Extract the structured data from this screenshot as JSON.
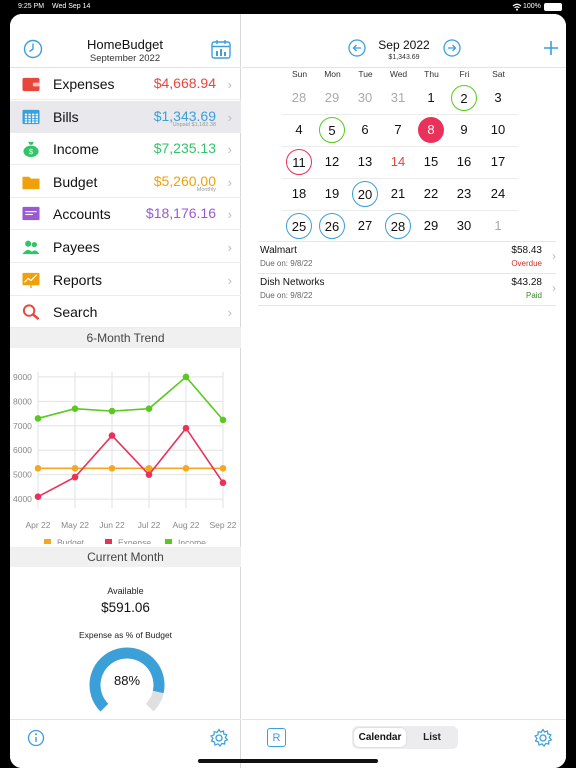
{
  "status_bar": {
    "time": "9:25 PM",
    "date": "Wed Sep 14",
    "battery": "100%"
  },
  "colors": {
    "expenses": "#e8453c",
    "bills": "#3b9fd8",
    "income": "#34c26a",
    "budget": "#f0a10a",
    "accounts": "#9b59d0",
    "accent": "#3b9fd8"
  },
  "left_header": {
    "title": "HomeBudget",
    "subtitle": "September 2022"
  },
  "menu": [
    {
      "label": "Expenses",
      "amount": "$4,668.94",
      "color": "#e8453c",
      "icon": "wallet-icon",
      "sub": ""
    },
    {
      "label": "Bills",
      "amount": "$1,343.69",
      "color": "#3b9fd8",
      "icon": "calendar-grid-icon",
      "sub": "Unpaid $1,182.38"
    },
    {
      "label": "Income",
      "amount": "$7,235.13",
      "color": "#34c26a",
      "icon": "money-bag-icon",
      "sub": ""
    },
    {
      "label": "Budget",
      "amount": "$5,260.00",
      "color": "#f0a10a",
      "icon": "folder-icon",
      "sub": "Monthly"
    },
    {
      "label": "Accounts",
      "amount": "$18,176.16",
      "color": "#9b59d0",
      "icon": "accounts-icon",
      "sub": ""
    },
    {
      "label": "Payees",
      "amount": "",
      "color": "#34c26a",
      "icon": "people-icon",
      "sub": ""
    },
    {
      "label": "Reports",
      "amount": "",
      "color": "#f0a10a",
      "icon": "chart-board-icon",
      "sub": ""
    },
    {
      "label": "Search",
      "amount": "",
      "color": "#e8453c",
      "icon": "magnifier-icon",
      "sub": ""
    }
  ],
  "trend_section": "6-Month Trend",
  "chart_data": {
    "type": "line",
    "title": "",
    "categories": [
      "Apr 22",
      "May 22",
      "Jun 22",
      "Jul 22",
      "Aug 22",
      "Sep 22"
    ],
    "ylim": [
      3800,
      9200
    ],
    "yticks": [
      "9000",
      "8000",
      "7000",
      "6000",
      "5000",
      "4000"
    ],
    "ytick_values": [
      9000,
      8000,
      7000,
      6000,
      5000,
      4000
    ],
    "grid": true,
    "legend_position": "bottom",
    "series": [
      {
        "name": "Budget",
        "color": "#f5a623",
        "values": [
          5260,
          5260,
          5260,
          5260,
          5260,
          5260
        ]
      },
      {
        "name": "Expense",
        "color": "#e8325a",
        "values": [
          4100,
          4900,
          6600,
          5000,
          6900,
          4670
        ]
      },
      {
        "name": "Income",
        "color": "#5ac820",
        "values": [
          7300,
          7700,
          7600,
          7700,
          9000,
          7240
        ]
      }
    ]
  },
  "current_month": {
    "section": "Current Month",
    "available_label": "Available",
    "available_value": "$591.06",
    "gauge_label": "Expense as % of Budget",
    "gauge_value": "88%",
    "gauge_fraction": 0.88
  },
  "calendar": {
    "month": "Sep 2022",
    "total": "$1,343.69",
    "weekdays": [
      "Sun",
      "Mon",
      "Tue",
      "Wed",
      "Thu",
      "Fri",
      "Sat"
    ],
    "weeks": [
      [
        {
          "d": "28",
          "s": "dim"
        },
        {
          "d": "29",
          "s": "dim"
        },
        {
          "d": "30",
          "s": "dim"
        },
        {
          "d": "31",
          "s": "dim"
        },
        {
          "d": "1",
          "s": ""
        },
        {
          "d": "2",
          "s": "ring-green"
        },
        {
          "d": "3",
          "s": ""
        }
      ],
      [
        {
          "d": "4",
          "s": ""
        },
        {
          "d": "5",
          "s": "ring-green"
        },
        {
          "d": "6",
          "s": ""
        },
        {
          "d": "7",
          "s": ""
        },
        {
          "d": "8",
          "s": "fill-pink"
        },
        {
          "d": "9",
          "s": ""
        },
        {
          "d": "10",
          "s": ""
        }
      ],
      [
        {
          "d": "11",
          "s": "ring-red"
        },
        {
          "d": "12",
          "s": ""
        },
        {
          "d": "13",
          "s": ""
        },
        {
          "d": "14",
          "s": "today"
        },
        {
          "d": "15",
          "s": ""
        },
        {
          "d": "16",
          "s": ""
        },
        {
          "d": "17",
          "s": ""
        }
      ],
      [
        {
          "d": "18",
          "s": ""
        },
        {
          "d": "19",
          "s": ""
        },
        {
          "d": "20",
          "s": "ring-blue"
        },
        {
          "d": "21",
          "s": ""
        },
        {
          "d": "22",
          "s": ""
        },
        {
          "d": "23",
          "s": ""
        },
        {
          "d": "24",
          "s": ""
        }
      ],
      [
        {
          "d": "25",
          "s": "ring-blue"
        },
        {
          "d": "26",
          "s": "ring-blue"
        },
        {
          "d": "27",
          "s": ""
        },
        {
          "d": "28",
          "s": "ring-blue"
        },
        {
          "d": "29",
          "s": ""
        },
        {
          "d": "30",
          "s": ""
        },
        {
          "d": "1",
          "s": "dim"
        }
      ]
    ]
  },
  "bills": [
    {
      "name": "Walmart",
      "due": "Due on: 9/8/22",
      "amount": "$58.43",
      "status": "Overdue",
      "status_color": "#d0302a"
    },
    {
      "name": "Dish Networks",
      "due": "Due on: 9/8/22",
      "amount": "$43.28",
      "status": "Paid",
      "status_color": "#3a8a2a"
    }
  ],
  "bottom_bar": {
    "segment_calendar": "Calendar",
    "segment_list": "List",
    "r_button": "R"
  }
}
